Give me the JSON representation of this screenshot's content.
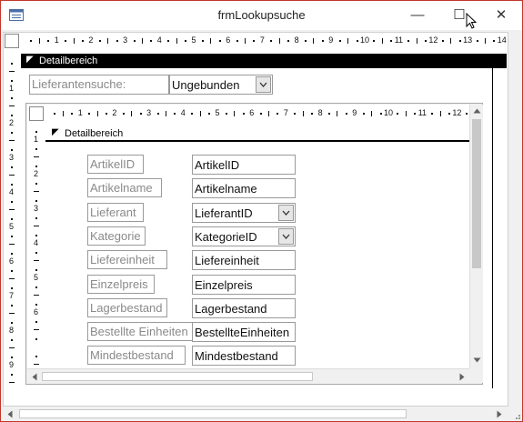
{
  "window": {
    "title": "frmLookupsuche",
    "close_glyph": "✕",
    "maximize_glyph": "☐",
    "minimize_glyph": "—"
  },
  "outer_ruler": {
    "numbers": [
      "1",
      "2",
      "3",
      "4",
      "5",
      "6",
      "7",
      "8",
      "9",
      "10",
      "11",
      "12",
      "13",
      "14"
    ]
  },
  "outer_vruler": {
    "numbers": [
      "1",
      "2",
      "3",
      "4",
      "5",
      "6",
      "7",
      "8",
      "9"
    ]
  },
  "outer_section": {
    "label": "Detailbereich"
  },
  "search": {
    "label": "Lieferantensuche:",
    "value": "Ungebunden"
  },
  "inner_ruler": {
    "numbers": [
      "1",
      "2",
      "3",
      "4",
      "5",
      "6",
      "7",
      "8",
      "9",
      "10",
      "11",
      "12"
    ]
  },
  "inner_vruler": {
    "numbers": [
      "1",
      "2",
      "3",
      "4",
      "5",
      "6"
    ]
  },
  "inner_section": {
    "label": "Detailbereich"
  },
  "fields": [
    {
      "label": "ArtikelID",
      "value": "ArtikelID",
      "combo": false
    },
    {
      "label": "Artikelname",
      "value": "Artikelname",
      "combo": false
    },
    {
      "label": "Lieferant",
      "value": "LieferantID",
      "combo": true
    },
    {
      "label": "Kategorie",
      "value": "KategorieID",
      "combo": true
    },
    {
      "label": "Liefereinheit",
      "value": "Liefereinheit",
      "combo": false
    },
    {
      "label": "Einzelpreis",
      "value": "Einzelpreis",
      "combo": false
    },
    {
      "label": "Lagerbestand",
      "value": "Lagerbestand",
      "combo": false
    },
    {
      "label": "Bestellte Einheiten",
      "value": "BestellteEinheiten",
      "combo": false
    },
    {
      "label": "Mindestbestand",
      "value": "Mindestbestand",
      "combo": false
    }
  ]
}
